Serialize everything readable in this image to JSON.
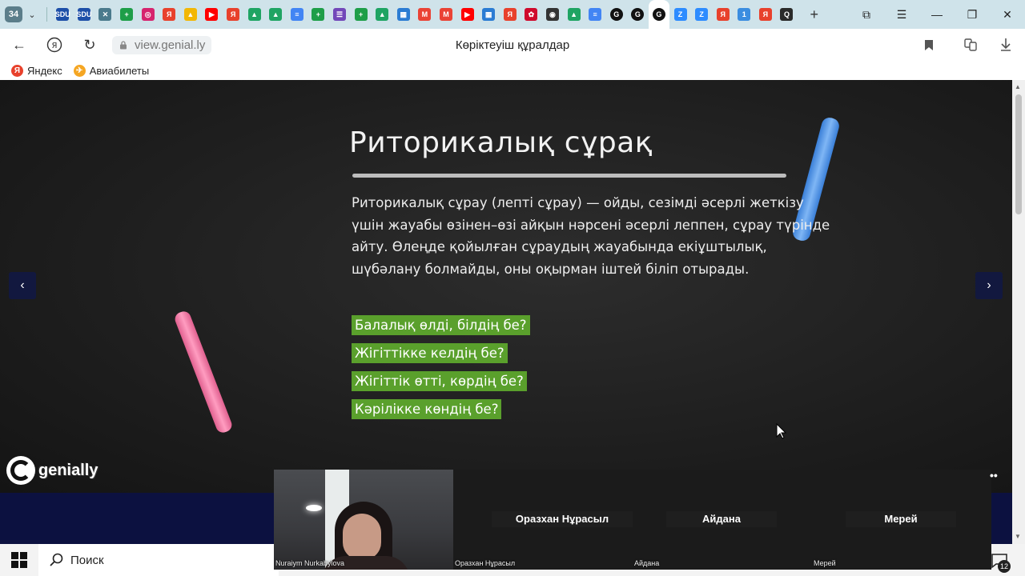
{
  "tabs": {
    "count": "34",
    "items": [
      {
        "icon": "sdu-icon",
        "color": "#1d4fa8",
        "glyph": "SDU"
      },
      {
        "icon": "sdu-icon",
        "color": "#1d4fa8",
        "glyph": "SDU"
      },
      {
        "icon": "x-cross-icon",
        "color": "#4a7a8c",
        "glyph": "✕"
      },
      {
        "icon": "green-plus-icon",
        "color": "#1e9e48",
        "glyph": "+"
      },
      {
        "icon": "instagram-icon",
        "color": "#d6246e",
        "glyph": "◎"
      },
      {
        "icon": "yandex-icon",
        "color": "#e8412c",
        "glyph": "Я"
      },
      {
        "icon": "mountain-icon",
        "color": "#f2b705",
        "glyph": "▲"
      },
      {
        "icon": "youtube-icon",
        "color": "#ff0000",
        "glyph": "▶"
      },
      {
        "icon": "yandex-icon",
        "color": "#e8412c",
        "glyph": "Я"
      },
      {
        "icon": "google-drive-icon",
        "color": "#1fa463",
        "glyph": "▲"
      },
      {
        "icon": "google-drive-icon",
        "color": "#1fa463",
        "glyph": "▲"
      },
      {
        "icon": "google-docs-icon",
        "color": "#4285f4",
        "glyph": "≡"
      },
      {
        "icon": "green-plus-icon",
        "color": "#1e9e48",
        "glyph": "+"
      },
      {
        "icon": "forms-icon",
        "color": "#7248b9",
        "glyph": "☰"
      },
      {
        "icon": "green-plus-icon",
        "color": "#1e9e48",
        "glyph": "+"
      },
      {
        "icon": "google-drive-icon",
        "color": "#1fa463",
        "glyph": "▲"
      },
      {
        "icon": "windows-grid-icon",
        "color": "#2b7cd3",
        "glyph": "▦"
      },
      {
        "icon": "gmail-icon",
        "color": "#ea4335",
        "glyph": "M"
      },
      {
        "icon": "gmail-icon",
        "color": "#ea4335",
        "glyph": "M"
      },
      {
        "icon": "youtube-icon",
        "color": "#ff0000",
        "glyph": "▶"
      },
      {
        "icon": "windows-grid-icon",
        "color": "#2b7cd3",
        "glyph": "▦"
      },
      {
        "icon": "yandex-icon",
        "color": "#e8412c",
        "glyph": "Я"
      },
      {
        "icon": "huawei-icon",
        "color": "#cf0a2c",
        "glyph": "✿"
      },
      {
        "icon": "compass-icon",
        "color": "#333333",
        "glyph": "◉"
      },
      {
        "icon": "google-drive-icon",
        "color": "#1fa463",
        "glyph": "▲"
      },
      {
        "icon": "google-docs-icon",
        "color": "#4285f4",
        "glyph": "≡"
      },
      {
        "icon": "genially-icon",
        "color": "#111111",
        "glyph": "G"
      },
      {
        "icon": "genially-icon",
        "color": "#111111",
        "glyph": "G"
      },
      {
        "icon": "genially-icon",
        "color": "#111111",
        "glyph": "G",
        "active": true
      },
      {
        "icon": "zoom-icon",
        "color": "#2d8cff",
        "glyph": "Z"
      },
      {
        "icon": "zoom-icon",
        "color": "#2d8cff",
        "glyph": "Z"
      },
      {
        "icon": "yandex-icon",
        "color": "#e8412c",
        "glyph": "Я"
      },
      {
        "icon": "number-one-icon",
        "color": "#3b8de0",
        "glyph": "1"
      },
      {
        "icon": "yandex-icon",
        "color": "#e8412c",
        "glyph": "Я"
      },
      {
        "icon": "quizlet-icon",
        "color": "#2a2a2a",
        "glyph": "Q"
      }
    ]
  },
  "address": {
    "url": "view.genial.ly",
    "title": "Көріктеуіш құралдар"
  },
  "bookmarks": [
    {
      "label": "Яндекс",
      "icon": "yandex-icon",
      "color": "#e8412c",
      "glyph": "Я"
    },
    {
      "label": "Авиабилеты",
      "icon": "plane-icon",
      "color": "#f5a623",
      "glyph": "✈"
    }
  ],
  "slide": {
    "title": "Риторикалық сұрақ",
    "paragraph": "Риторикалық сұрау (лепті сұрау) — ойды, сезімді әсерлі жеткізу үшін жауабы өзінен–өзі айқын нәрсені әсерлі леппен, сұрау түрінде айту. Өлеңде қойылған сұраудың жауабында екіұштылық, шүбәлану болмайды, оны оқырман іштей біліп отырады.",
    "questions": [
      "Балалық өлді, білдің бе?",
      "Жігіттікке келдің бе?",
      "Жігіттік өтті, көрдің бе?",
      "Кәрілікке көндің бе?"
    ],
    "highlight_color": "#5aa02c",
    "logo_text": "genially"
  },
  "taskbar": {
    "search_placeholder": "Поиск",
    "notification_count": "12"
  },
  "call": {
    "self_name": "Nuraiym Nurkabylova",
    "participants": [
      {
        "display": "Оразхан Нұрасыл",
        "caption": "Оразхан Нұрасыл"
      },
      {
        "display": "Айдана",
        "caption": "Айдана"
      },
      {
        "display": "Мерей",
        "caption": "Мерей"
      }
    ]
  }
}
